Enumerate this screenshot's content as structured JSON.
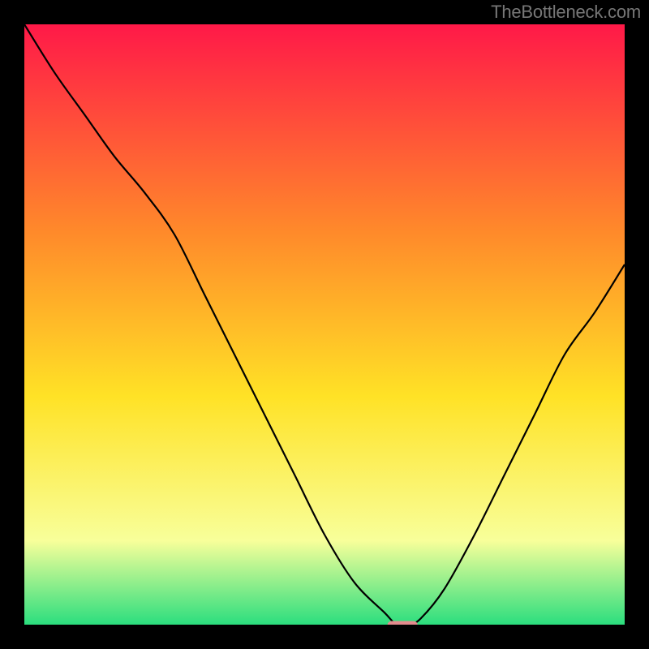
{
  "watermark": "TheBottleneck.com",
  "chart_data": {
    "type": "line",
    "title": "",
    "xlabel": "",
    "ylabel": "",
    "xlim": [
      0,
      100
    ],
    "ylim": [
      0,
      100
    ],
    "grid": false,
    "legend": false,
    "background_gradient": {
      "top": "#ff1948",
      "upper_mid": "#ff8b2a",
      "mid": "#ffe226",
      "lower_mid": "#f8ff9a",
      "bottom": "#2bde7e"
    },
    "series": [
      {
        "name": "bottleneck-curve",
        "color": "#000000",
        "x": [
          0,
          5,
          10,
          15,
          20,
          25,
          30,
          35,
          40,
          45,
          50,
          55,
          60,
          62,
          64,
          66,
          70,
          75,
          80,
          85,
          90,
          95,
          100
        ],
        "y": [
          100,
          92,
          85,
          78,
          72,
          65,
          55,
          45,
          35,
          25,
          15,
          7,
          2,
          0,
          0,
          1,
          6,
          15,
          25,
          35,
          45,
          52,
          60
        ]
      }
    ],
    "markers": [
      {
        "name": "optimal-marker",
        "shape": "rounded-rect",
        "color": "#e38b8d",
        "x": 63,
        "y": 0,
        "width_frac": 0.05,
        "height_frac": 0.012
      }
    ]
  }
}
